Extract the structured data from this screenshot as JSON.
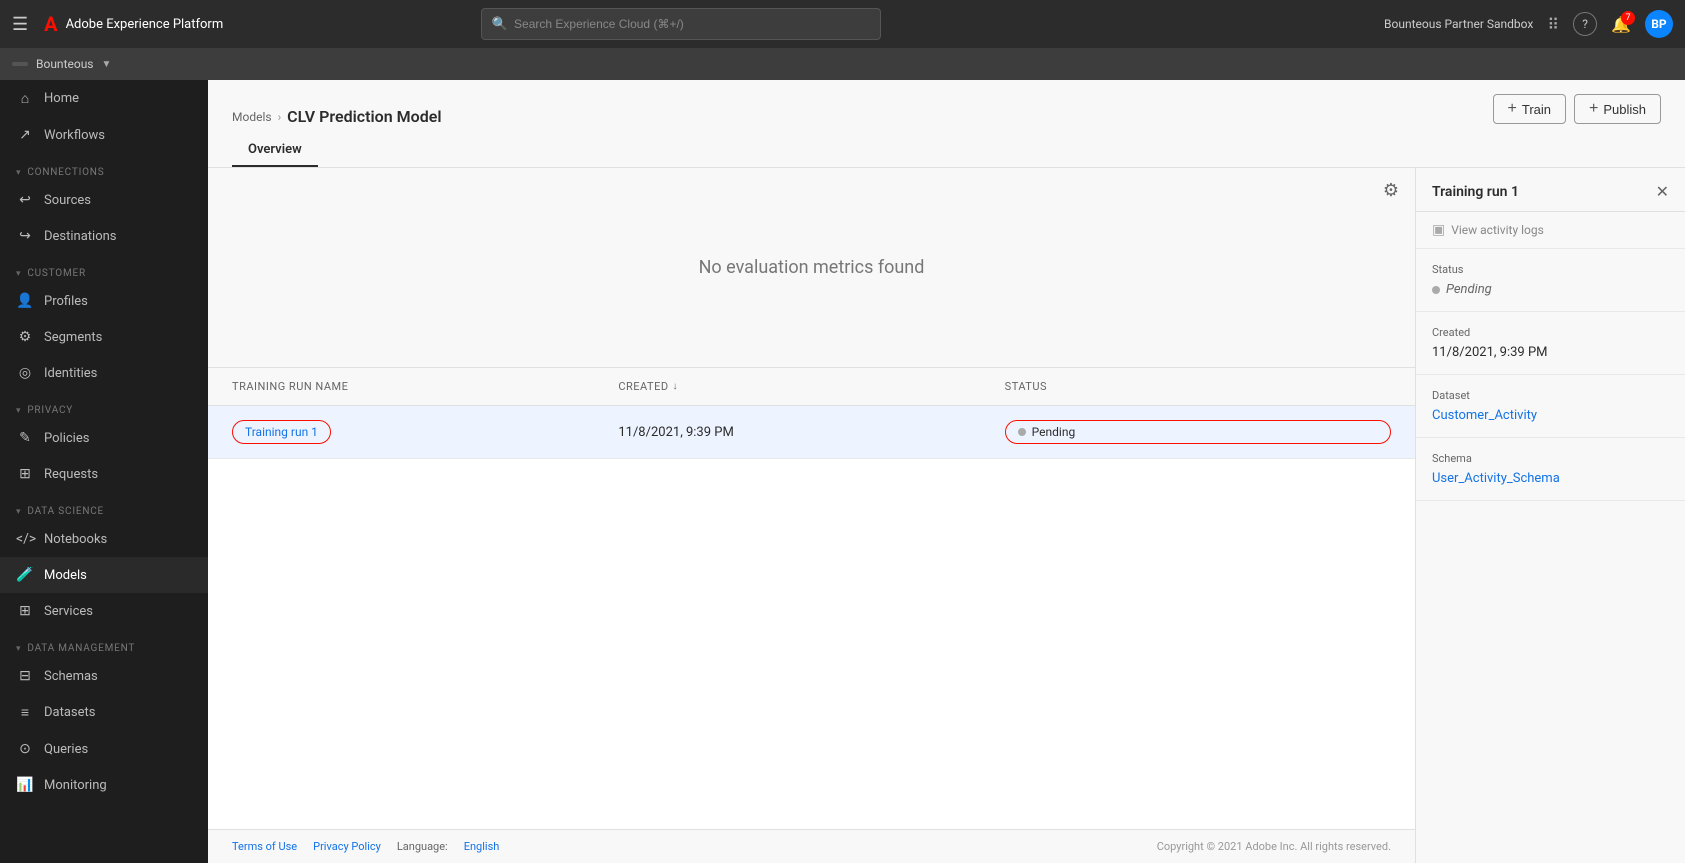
{
  "topbar": {
    "app_name": "Adobe Experience Platform",
    "search_placeholder": "Search Experience Cloud (⌘+/)",
    "org_name": "Bounteous Partner Sandbox",
    "menu_icon": "☰",
    "adobe_logo": "A",
    "grid_icon": "⠿",
    "help_icon": "?",
    "notification_count": "7",
    "user_initials": "BP"
  },
  "org_bar": {
    "pill_text": "Bounteous",
    "org_display": "Bounteous",
    "chevron": "▼"
  },
  "sidebar": {
    "home_label": "Home",
    "workflows_label": "Workflows",
    "connections_section": "CONNECTIONS",
    "sources_label": "Sources",
    "destinations_label": "Destinations",
    "customer_section": "CUSTOMER",
    "profiles_label": "Profiles",
    "segments_label": "Segments",
    "identities_label": "Identities",
    "privacy_section": "PRIVACY",
    "policies_label": "Policies",
    "requests_label": "Requests",
    "data_science_section": "DATA SCIENCE",
    "notebooks_label": "Notebooks",
    "models_label": "Models",
    "services_label": "Services",
    "data_management_section": "DATA MANAGEMENT",
    "schemas_label": "Schemas",
    "datasets_label": "Datasets",
    "queries_label": "Queries",
    "monitoring_label": "Monitoring"
  },
  "page": {
    "breadcrumb_parent": "Models",
    "breadcrumb_current": "CLV Prediction Model",
    "tab_overview": "Overview",
    "train_button": "Train",
    "publish_button": "Publish",
    "plus_icon": "+"
  },
  "metrics": {
    "empty_message": "No evaluation metrics found",
    "filter_icon": "⚙"
  },
  "table": {
    "col_training_run": "TRAINING RUN NAME",
    "col_created": "CREATED",
    "col_status": "STATUS",
    "sort_arrow": "↓",
    "rows": [
      {
        "name": "Training run 1",
        "created": "11/8/2021, 9:39 PM",
        "status": "Pending"
      }
    ]
  },
  "right_panel": {
    "title": "Training run 1",
    "close_icon": "✕",
    "view_activity_logs": "View activity logs",
    "activity_icon": "▣",
    "status_label": "Status",
    "status_value": "Pending",
    "created_label": "Created",
    "created_value": "11/8/2021, 9:39 PM",
    "dataset_label": "Dataset",
    "dataset_value": "Customer_Activity",
    "schema_label": "Schema",
    "schema_value": "User_Activity_Schema"
  },
  "footer": {
    "terms_label": "Terms of Use",
    "privacy_label": "Privacy Policy",
    "language_label": "Language:",
    "language_value": "English",
    "copyright": "Copyright © 2021 Adobe Inc. All rights reserved."
  }
}
